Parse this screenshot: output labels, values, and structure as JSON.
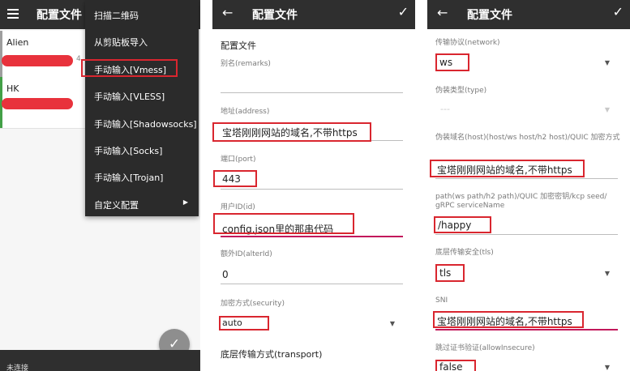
{
  "panel_main": {
    "title": "配置文件",
    "servers": [
      {
        "name": "Alien",
        "stripe_color": "#9e9e9e",
        "tail": "4"
      },
      {
        "name": "HK",
        "stripe_color": "#43a047"
      }
    ],
    "menu": [
      {
        "label": "扫描二维码"
      },
      {
        "label": "从剪贴板导入"
      },
      {
        "label": "手动输入[Vmess]"
      },
      {
        "label": "手动输入[VLESS]"
      },
      {
        "label": "手动输入[Shadowsocks]"
      },
      {
        "label": "手动输入[Socks]"
      },
      {
        "label": "手动输入[Trojan]"
      },
      {
        "label": "自定义配置"
      }
    ],
    "status": "未连接"
  },
  "panel_form1": {
    "title": "配置文件",
    "section": "配置文件",
    "remarks_label": "别名(remarks)",
    "remarks_value": "",
    "address_label": "地址(address)",
    "address_value": "宝塔刚刚网站的域名,不带https",
    "port_label": "端口(port)",
    "port_value": "443",
    "id_label": "用户ID(id)",
    "id_value": "config.json里的那串代码",
    "alterid_label": "额外ID(alterId)",
    "alterid_value": "0",
    "security_label": "加密方式(security)",
    "security_value": "auto",
    "transport_section": "底层传输方式(transport)"
  },
  "panel_form2": {
    "title": "配置文件",
    "network_label": "传输协议(network)",
    "network_value": "ws",
    "type_label": "伪装类型(type)",
    "type_value": "---",
    "host_label": "伪装域名(host)(host/ws host/h2 host)/QUIC 加密方式",
    "host_value": "宝塔刚刚网站的域名,不带https",
    "path_label": "path(ws path/h2 path)/QUIC 加密密钥/kcp seed/ gRPC serviceName",
    "path_value": "/happy",
    "tls_label": "底层传输安全(tls)",
    "tls_value": "tls",
    "sni_label": "SNI",
    "sni_value": "宝塔刚刚网站的域名,不带https",
    "insecure_label": "跳过证书验证(allowInsecure)",
    "insecure_value": "false"
  },
  "colors": {
    "appbar": "#2f2f2f",
    "highlight_box": "#d9262f",
    "active_underline": "#c2185b"
  },
  "icons": [
    "menu-icon",
    "back-arrow-icon",
    "check-icon",
    "dropdown-caret-icon",
    "submenu-arrow-icon",
    "connect-fab-icon"
  ]
}
